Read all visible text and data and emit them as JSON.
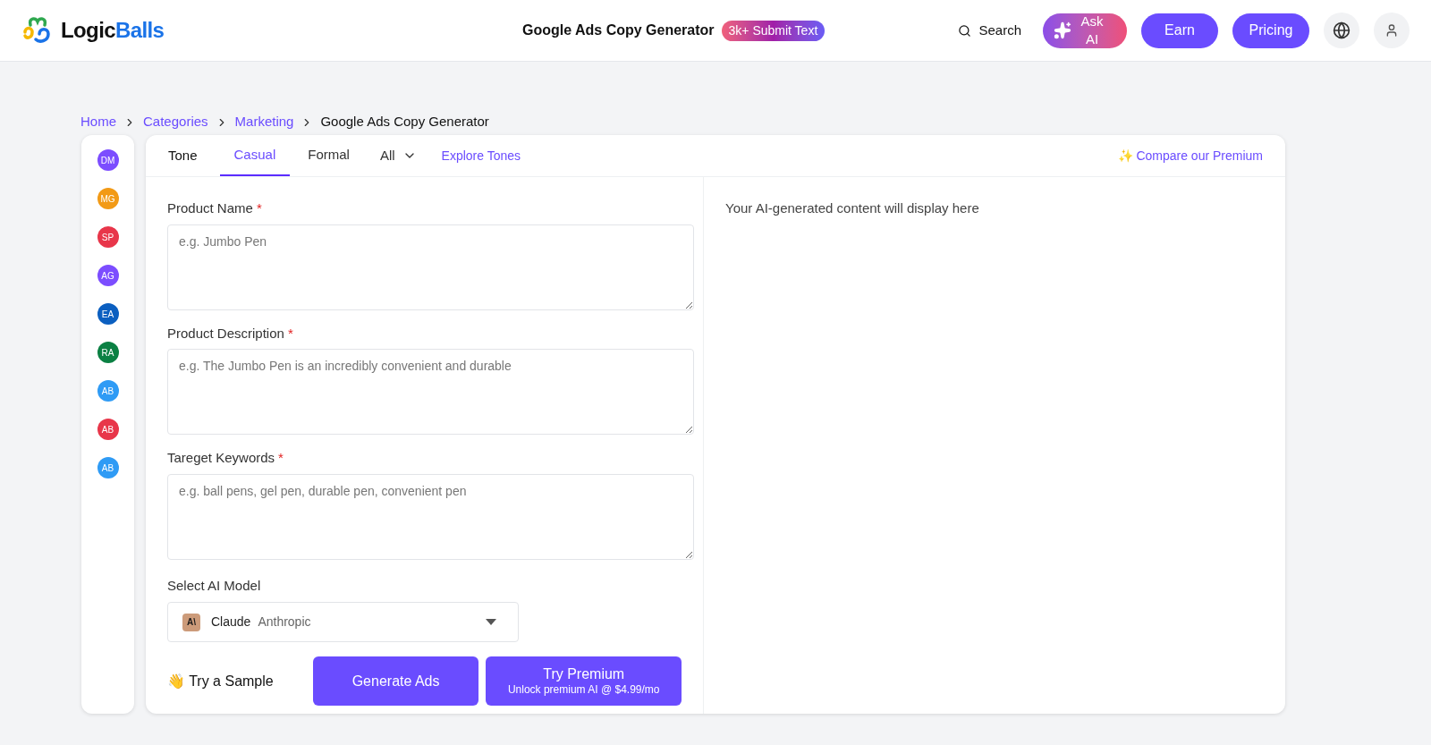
{
  "header": {
    "logo": {
      "first": "Logic",
      "second": "Balls"
    },
    "title": "Google Ads Copy Generator",
    "badge": "3k+ Submit Text",
    "search": "Search",
    "ask_ai": "Ask AI",
    "earn": "Earn",
    "pricing": "Pricing"
  },
  "breadcrumb": [
    {
      "label": "Home"
    },
    {
      "label": "Categories"
    },
    {
      "label": "Marketing"
    },
    {
      "label": "Google Ads Copy Generator"
    }
  ],
  "sidebar": {
    "avatars": [
      {
        "initials": "DM",
        "color": "#7c4dff"
      },
      {
        "initials": "MG",
        "color": "#f29a16"
      },
      {
        "initials": "SP",
        "color": "#e8364a"
      },
      {
        "initials": "AG",
        "color": "#7c4dff"
      },
      {
        "initials": "EA",
        "color": "#0b5fc0"
      },
      {
        "initials": "RA",
        "color": "#0b8043"
      },
      {
        "initials": "AB",
        "color": "#2f9bf5"
      },
      {
        "initials": "AB",
        "color": "#e8364a"
      },
      {
        "initials": "AB",
        "color": "#2f9bf5"
      }
    ]
  },
  "tone": {
    "label": "Tone",
    "tabs": [
      {
        "label": "Casual",
        "selected": true
      },
      {
        "label": "Formal",
        "selected": false
      }
    ],
    "all": "All",
    "explore": "Explore Tones",
    "compare": "✨ Compare our Premium"
  },
  "form": {
    "fields": [
      {
        "label": "Product Name",
        "required_mark": "*",
        "placeholder": "e.g. Jumbo Pen"
      },
      {
        "label": "Product Description",
        "required_mark": "*",
        "placeholder": "e.g. The Jumbo Pen is an incredibly convenient and durable"
      },
      {
        "label": "Tareget Keywords",
        "required_mark": "*",
        "placeholder": "e.g. ball pens, gel pen, durable pen, convenient pen"
      }
    ],
    "model": {
      "label": "Select AI Model",
      "name": "Claude",
      "vendor": "Anthropic",
      "logo": "A\\"
    },
    "sample": "👋 Try a Sample",
    "generate": "Generate Ads",
    "premium": {
      "title": "Try Premium",
      "subtitle": "Unlock premium AI @ $4.99/mo"
    }
  },
  "output": {
    "placeholder": "Your AI-generated content will display here"
  }
}
